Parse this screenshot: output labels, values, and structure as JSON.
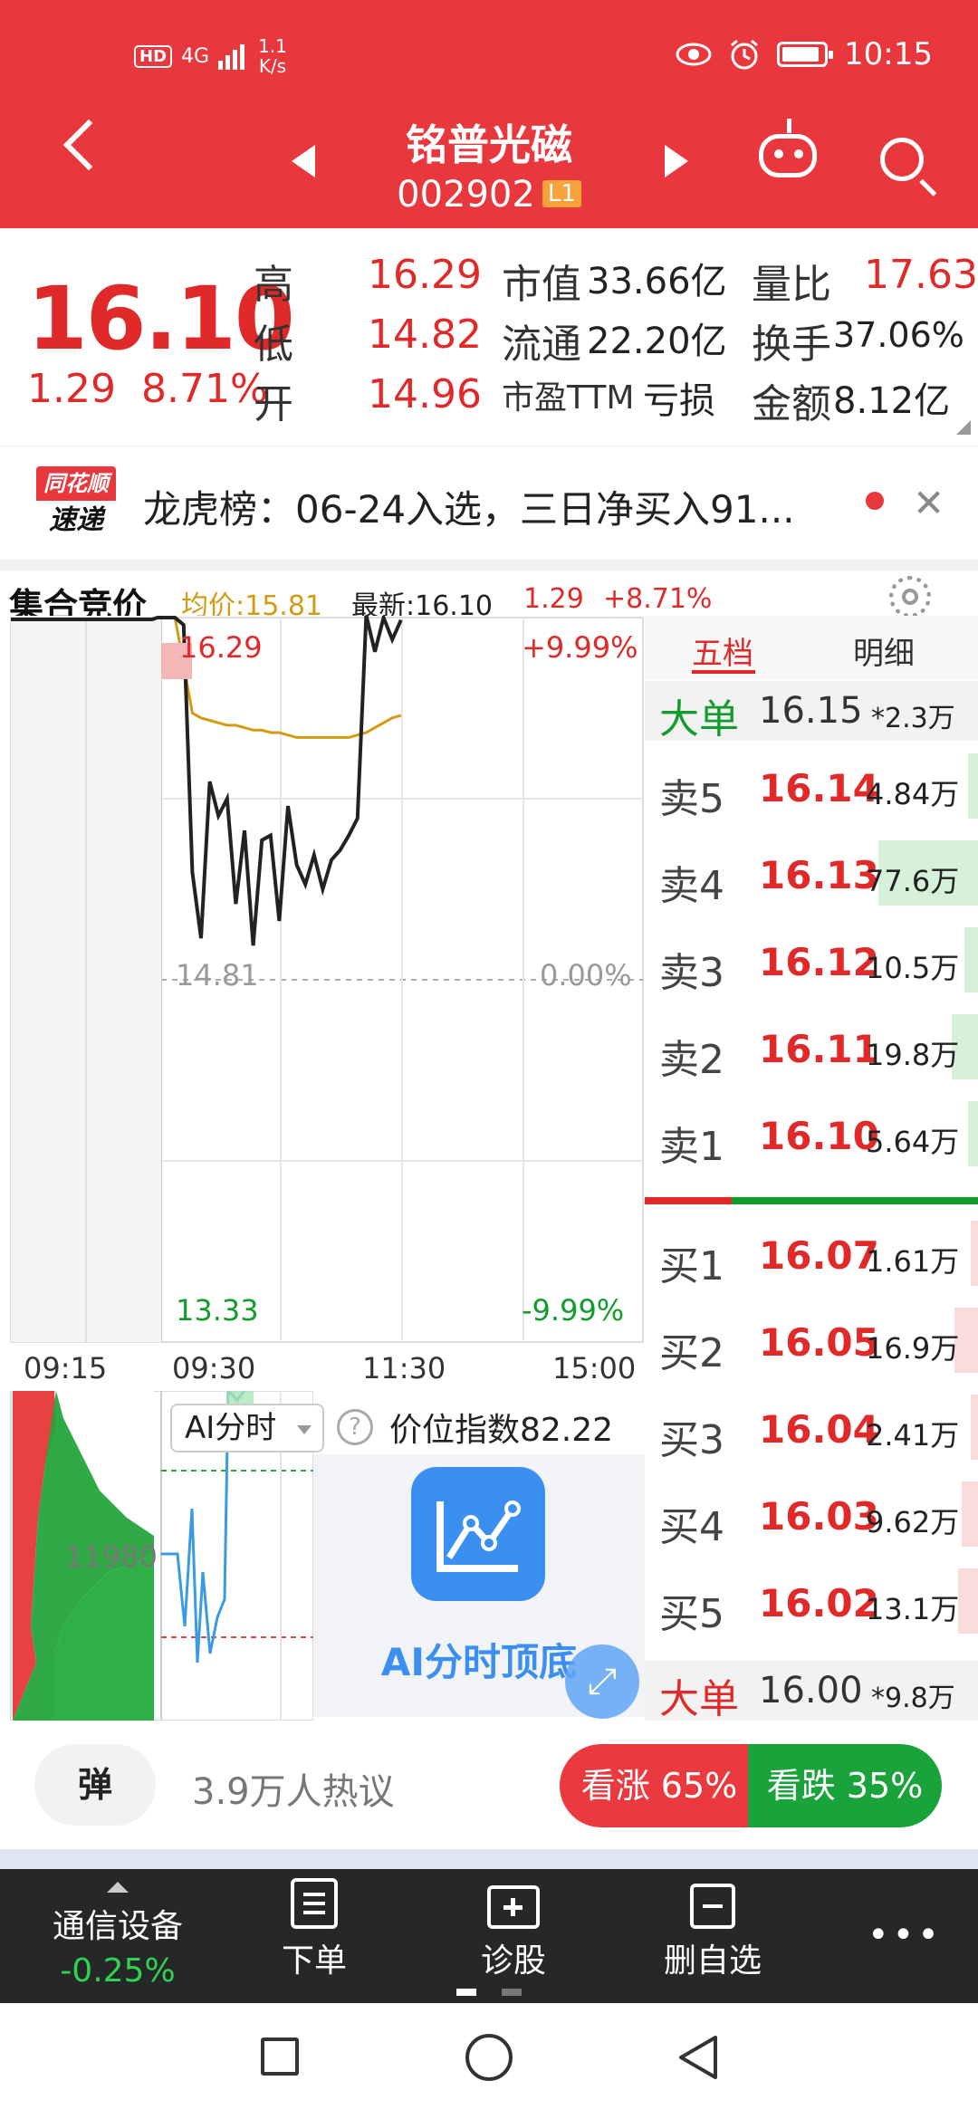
{
  "status_bar": {
    "hd": "HD",
    "network": "4G",
    "speed_value": "1.1",
    "speed_unit": "K/s",
    "time": "10:15"
  },
  "header": {
    "stock_name": "铭普光磁",
    "stock_code": "002902",
    "level": "L1"
  },
  "quote": {
    "price": "16.10",
    "change": "1.29",
    "change_pct": "8.71%",
    "high_label": "高",
    "high": "16.29",
    "low_label": "低",
    "low": "14.82",
    "open_label": "开",
    "open": "14.96",
    "mktcap_label": "市值",
    "mktcap": "33.66亿",
    "float_label": "流通",
    "float": "22.20亿",
    "pe_label": "市盈TTM",
    "pe": "亏损",
    "volratio_label": "量比",
    "volratio": "17.63",
    "turnover_label": "换手",
    "turnover": "37.06%",
    "amount_label": "金额",
    "amount": "8.12亿"
  },
  "news": {
    "logo_top": "同花顺",
    "logo_bottom": "速递",
    "text": "龙虎榜：06-24入选，三日净买入91..."
  },
  "chart_header": {
    "title": "集合竞价",
    "avg": "均价:15.81",
    "latest": "最新:16.10",
    "change": "1.29",
    "pct": "+8.71%"
  },
  "chart_data": {
    "type": "line",
    "ylim": [
      13.33,
      16.29
    ],
    "y_ticks_left": [
      "16.29",
      "14.81",
      "13.33"
    ],
    "y_ticks_right": [
      "+9.99%",
      "0.00%",
      "-9.99%"
    ],
    "x_ticks": [
      "09:15",
      "09:30",
      "11:30",
      "15:00"
    ],
    "series": [
      {
        "values": [
          16.29,
          16.29,
          16.29,
          16.26,
          15.25,
          14.98,
          15.62,
          15.48,
          15.55,
          15.12,
          15.42,
          14.95,
          15.38,
          15.4,
          15.05,
          15.52,
          15.28,
          15.2,
          15.32,
          15.18,
          15.3,
          15.34,
          15.4,
          15.47,
          16.3,
          16.15,
          16.29,
          16.2,
          16.28
        ]
      },
      {
        "values": [
          16.29,
          16.29,
          16.29,
          16.1,
          15.9,
          15.88,
          15.87,
          15.86,
          15.85,
          15.85,
          15.84,
          15.83,
          15.83,
          15.82,
          15.82,
          15.81,
          15.8,
          15.8,
          15.8,
          15.8,
          15.8,
          15.8,
          15.8,
          15.81,
          15.82,
          15.84,
          15.86,
          15.88,
          15.89
        ]
      }
    ]
  },
  "order_book": {
    "tab_active": "五档",
    "tab_detail": "明细",
    "big_sell": {
      "label": "大单",
      "price": "16.15",
      "vol": "*2.3万"
    },
    "asks": [
      {
        "label": "卖5",
        "price": "16.14",
        "vol": "4.84万",
        "bar": 0.03
      },
      {
        "label": "卖4",
        "price": "16.13",
        "vol": "77.6万",
        "bar": 0.3
      },
      {
        "label": "卖3",
        "price": "16.12",
        "vol": "10.5万",
        "bar": 0.04
      },
      {
        "label": "卖2",
        "price": "16.11",
        "vol": "19.8万",
        "bar": 0.08
      },
      {
        "label": "卖1",
        "price": "16.10",
        "vol": "5.64万",
        "bar": 0.03
      }
    ],
    "bids": [
      {
        "label": "买1",
        "price": "16.07",
        "vol": "1.61万",
        "bar": 0.02
      },
      {
        "label": "买2",
        "price": "16.05",
        "vol": "16.9万",
        "bar": 0.07
      },
      {
        "label": "买3",
        "price": "16.04",
        "vol": "2.41万",
        "bar": 0.02
      },
      {
        "label": "买4",
        "price": "16.03",
        "vol": "9.62万",
        "bar": 0.05
      },
      {
        "label": "买5",
        "price": "16.02",
        "vol": "13.1万",
        "bar": 0.06
      }
    ],
    "big_buy": {
      "label": "大单",
      "price": "16.00",
      "vol": "*9.8万"
    }
  },
  "subchart": {
    "volume_label": "11980",
    "ai_pill": "AI分时",
    "help": "?",
    "price_index": "价位指数82.22",
    "ai_card_text": "AI分时顶底"
  },
  "social": {
    "danmu": "弹",
    "hot": "3.9万人热议",
    "bull": "看涨 65%",
    "bear": "看跌 35%"
  },
  "toolbar": {
    "sector_name": "通信设备",
    "sector_change": "-0.25%",
    "order": "下单",
    "diagnose": "诊股",
    "remove_fav": "删自选",
    "more": "•••"
  },
  "colors": {
    "brand_red": "#e8383d",
    "up_red": "#e02a2a",
    "down_green": "#119c2b",
    "avg_line": "#d49a12",
    "ai_blue": "#3a8ff0"
  }
}
